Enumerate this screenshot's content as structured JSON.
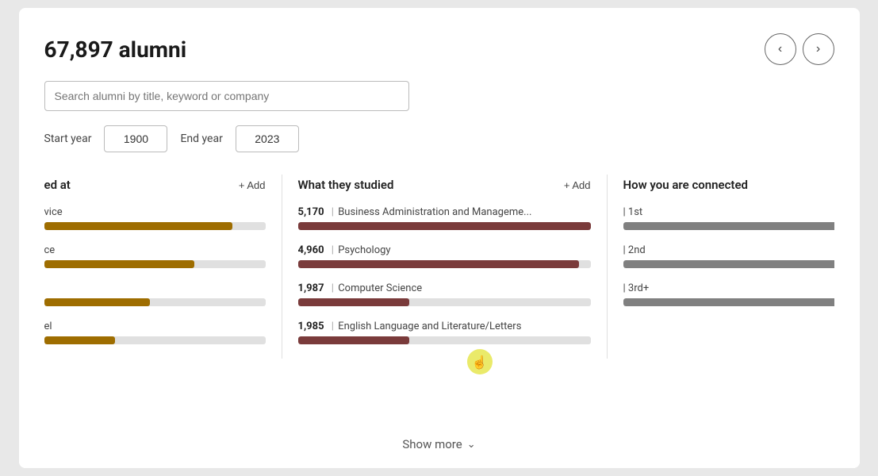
{
  "header": {
    "alumni_count": "67,897 alumni",
    "prev_button_label": "‹",
    "next_button_label": "›"
  },
  "search": {
    "placeholder": "Search alumni by title, keyword or company"
  },
  "year_filter": {
    "start_label": "Start year",
    "start_value": "1900",
    "end_label": "End year",
    "end_value": "2023"
  },
  "column_left": {
    "title": "ed at",
    "add_label": "+ Add",
    "items": [
      {
        "label": "vice",
        "count": null,
        "fill_pct": 85
      },
      {
        "label": "ce",
        "count": null,
        "fill_pct": 68
      },
      {
        "label": "",
        "count": null,
        "fill_pct": 48
      },
      {
        "label": "el",
        "count": null,
        "fill_pct": 32
      }
    ]
  },
  "column_middle": {
    "title": "What they studied",
    "add_label": "+ Add",
    "items": [
      {
        "count": "5,170",
        "label": "Business Administration and Manageme...",
        "fill_pct": 100
      },
      {
        "count": "4,960",
        "label": "Psychology",
        "fill_pct": 96
      },
      {
        "count": "1,987",
        "label": "Computer Science",
        "fill_pct": 38
      },
      {
        "count": "1,985",
        "label": "English Language and Literature/Letters",
        "fill_pct": 38
      }
    ]
  },
  "column_right": {
    "title": "How you are connected",
    "items": [
      {
        "label": "| 1st",
        "fill_pct": 100
      },
      {
        "label": "| 2nd",
        "fill_pct": 100
      },
      {
        "label": "| 3rd+",
        "fill_pct": 100
      }
    ]
  },
  "show_more": {
    "label": "Show more",
    "chevron": "›"
  }
}
